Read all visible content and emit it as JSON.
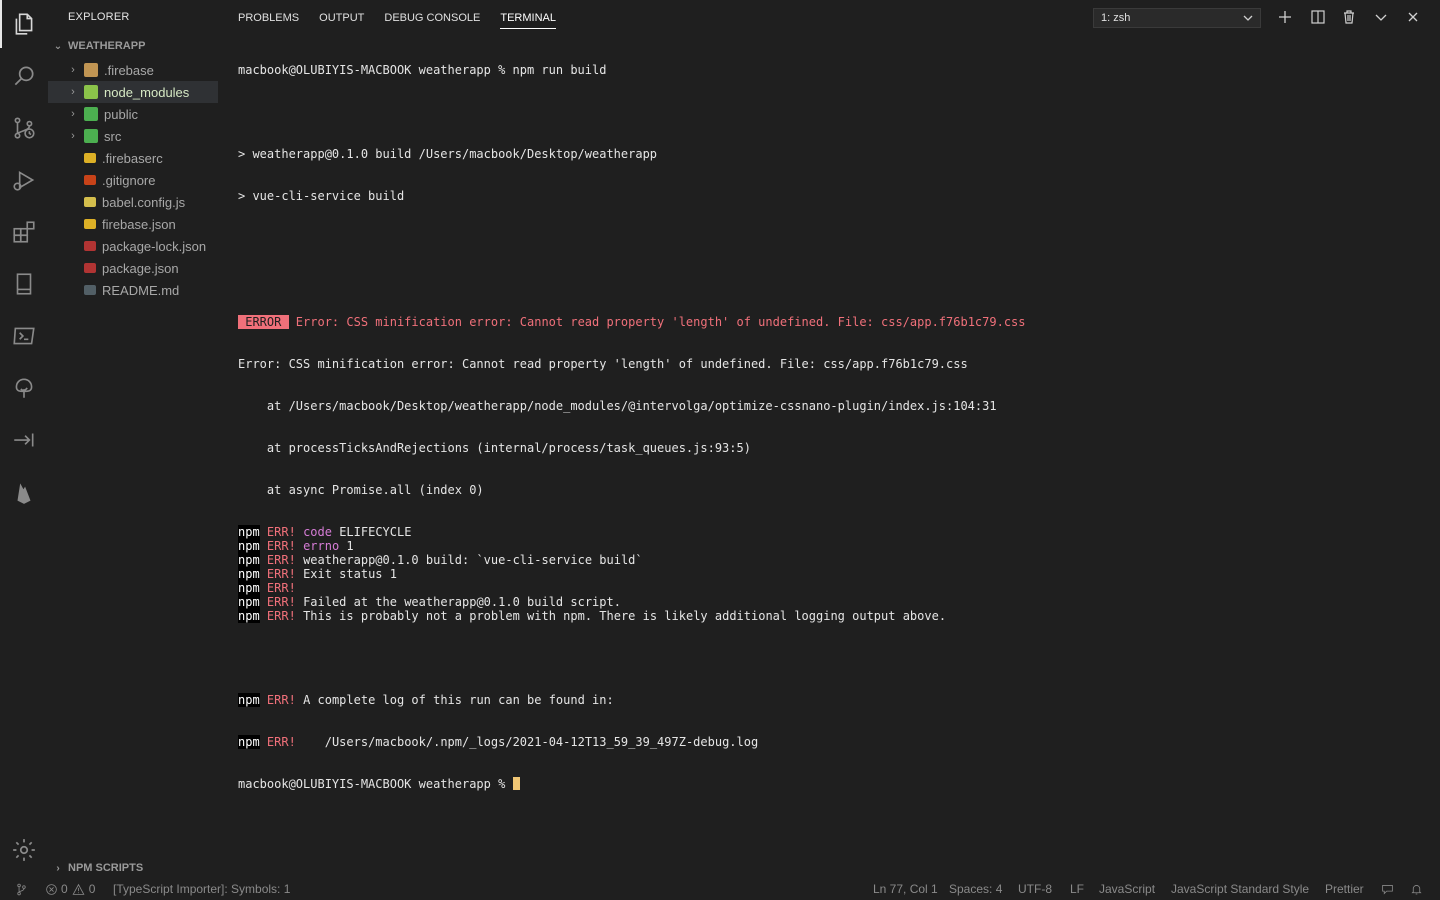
{
  "sidebar": {
    "title": "EXPLORER",
    "folder": "WEATHERAPP",
    "items": [
      {
        "label": ".firebase",
        "kind": "folder",
        "color": "#c09553"
      },
      {
        "label": "node_modules",
        "kind": "folder",
        "color": "#8bc34a",
        "selected": true
      },
      {
        "label": "public",
        "kind": "folder",
        "color": "#4caf50"
      },
      {
        "label": "src",
        "kind": "folder",
        "color": "#4caf50"
      },
      {
        "label": ".firebaserc",
        "kind": "file",
        "color": "#ffca28"
      },
      {
        "label": ".gitignore",
        "kind": "file",
        "color": "#e64a19"
      },
      {
        "label": "babel.config.js",
        "kind": "file",
        "color": "#f5da55"
      },
      {
        "label": "firebase.json",
        "kind": "file",
        "color": "#ffca28"
      },
      {
        "label": "package-lock.json",
        "kind": "file",
        "color": "#cb3837"
      },
      {
        "label": "package.json",
        "kind": "file",
        "color": "#cb3837"
      },
      {
        "label": "README.md",
        "kind": "file",
        "color": "#5c6b73"
      }
    ],
    "npm_scripts": "NPM SCRIPTS"
  },
  "panel": {
    "tabs": [
      "PROBLEMS",
      "OUTPUT",
      "DEBUG CONSOLE",
      "TERMINAL"
    ],
    "active_tab": "TERMINAL",
    "terminal_select": "1: zsh"
  },
  "terminal": {
    "prompt1": "macbook@OLUBIYIS-MACBOOK weatherapp % npm run build",
    "build1": "> weatherapp@0.1.0 build /Users/macbook/Desktop/weatherapp",
    "build2": "> vue-cli-service build",
    "error_badge": " ERROR ",
    "error_msg": " Error: CSS minification error: Cannot read property 'length' of undefined. File: css/app.f76b1c79.css",
    "err_line1": "Error: CSS minification error: Cannot read property 'length' of undefined. File: css/app.f76b1c79.css",
    "err_line2": "    at /Users/macbook/Desktop/weatherapp/node_modules/@intervolga/optimize-cssnano-plugin/index.js:104:31",
    "err_line3": "    at processTicksAndRejections (internal/process/task_queues.js:93:5)",
    "err_line4": "    at async Promise.all (index 0)",
    "npm": "npm",
    "err": "ERR!",
    "npm_lines": [
      {
        "kw": "code",
        "rest": " ELIFECYCLE",
        "magenta": true
      },
      {
        "kw": "errno",
        "rest": " 1",
        "magenta": true
      },
      {
        "kw": "",
        "rest": "weatherapp@0.1.0 build: `vue-cli-service build`",
        "magenta": false
      },
      {
        "kw": "",
        "rest": "Exit status 1",
        "magenta": false
      },
      {
        "kw": "",
        "rest": "",
        "magenta": false
      },
      {
        "kw": "",
        "rest": "Failed at the weatherapp@0.1.0 build script.",
        "magenta": false
      },
      {
        "kw": "",
        "rest": "This is probably not a problem with npm. There is likely additional logging output above.",
        "magenta": false
      }
    ],
    "log1": "A complete log of this run can be found in:",
    "log2": "    /Users/macbook/.npm/_logs/2021-04-12T13_59_39_497Z-debug.log",
    "prompt2": "macbook@OLUBIYIS-MACBOOK weatherapp % "
  },
  "statusbar": {
    "errors": "0",
    "warnings": "0",
    "ts_importer": "[TypeScript Importer]: Symbols: 1",
    "position": "Ln 77, Col 1",
    "spaces": "Spaces: 4",
    "encoding": "UTF-8",
    "eol": "LF",
    "language": "JavaScript",
    "style": "JavaScript Standard Style",
    "prettier": "Prettier"
  }
}
